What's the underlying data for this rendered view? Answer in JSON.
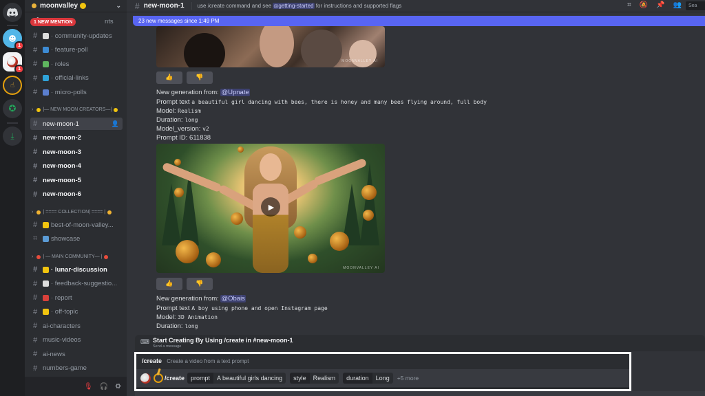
{
  "server": {
    "name": "moonvalley"
  },
  "sidebar": {
    "mention_pill": "1 NEW MENTION",
    "mention_channel_tail": "nts",
    "channels_top": [
      {
        "label": "· community-updates",
        "emoji_color": "#dddddd"
      },
      {
        "label": "· feature-poll",
        "emoji_color": "#3d8bd4"
      },
      {
        "label": "· roles",
        "emoji_color": "#5fb55f"
      },
      {
        "label": "· official-links",
        "emoji_color": "#2fa3d9"
      },
      {
        "label": "· micro-polls",
        "emoji_color": "#5b7fcf"
      }
    ],
    "category_new_moon": "|— NEW MOON CREATORS—|",
    "new_moon_channels": [
      {
        "label": "new-moon-1",
        "state": "active"
      },
      {
        "label": "new-moon-2",
        "state": "unread"
      },
      {
        "label": "new-moon-3",
        "state": "unread"
      },
      {
        "label": "new-moon-4",
        "state": "unread"
      },
      {
        "label": "new-moon-5",
        "state": "unread"
      },
      {
        "label": "new-moon-6",
        "state": "unread"
      }
    ],
    "category_collection": "| ==== COLLECTION| ==== |",
    "collection_channels": [
      {
        "label": "best-of-moon-valley...",
        "emoji_color": "#f1c40f"
      },
      {
        "label": "showcase",
        "emoji_color": "#5b9bd5"
      }
    ],
    "category_main": "| — MAIN COMMUNITY— |",
    "main_channels": [
      {
        "label": "· lunar-discussion",
        "bold": true,
        "emoji_color": "#f1c40f"
      },
      {
        "label": "· feedback-suggestio...",
        "bold": false,
        "emoji_color": "#dddddd"
      },
      {
        "label": "· report",
        "bold": false,
        "emoji_color": "#d9413b"
      },
      {
        "label": "· off-topic",
        "bold": false,
        "emoji_color": "#f1c40f"
      },
      {
        "label": "ai-characters",
        "bold": false,
        "emoji_color": ""
      },
      {
        "label": "music-videos",
        "bold": false,
        "emoji_color": ""
      },
      {
        "label": "ai-news",
        "bold": false,
        "emoji_color": ""
      },
      {
        "label": "numbers-game",
        "bold": false,
        "emoji_color": ""
      }
    ]
  },
  "topbar": {
    "channel": "new-moon-1",
    "topic_before": "use /create command and see ",
    "topic_link": "getting-started",
    "topic_after": " for instructions and supported flags",
    "search": "Sea"
  },
  "new_messages_bar": "23 new messages since 1:49 PM",
  "messages": [
    {
      "header": "New generation from: ",
      "mention": "@Upnate",
      "prompt_label": "Prompt text ",
      "prompt": "a beautiful girl dancing with bees, there is honey and many bees flying around, full body",
      "model_label": "Model: ",
      "model": "Realism",
      "duration_label": "Duration: ",
      "duration": "long",
      "version_label": "Model_version: ",
      "version": "v2",
      "id_label": "Prompt ID: ",
      "id": "611838"
    },
    {
      "header": "New generation from: ",
      "mention": "@Obais",
      "prompt_label": "Prompt text ",
      "prompt": "A boy using phone and open Instagram page",
      "model_label": "Model: ",
      "model": "3D Animation",
      "duration_label": "Duration: ",
      "duration": "long"
    }
  ],
  "watermark": "MOONVALLEY AI",
  "command_hint": {
    "title": "Start Creating By Using /create in #new-moon-1",
    "subtitle": "Send a message"
  },
  "composer": {
    "option_command": "/create",
    "option_desc": "Create a video from a text prompt",
    "command": "/create",
    "chips": [
      {
        "key": "prompt",
        "value": "A beautiful girls dancing"
      },
      {
        "key": "style",
        "value": "Realism"
      },
      {
        "key": "duration",
        "value": "Long"
      }
    ],
    "more": "+5 more"
  }
}
